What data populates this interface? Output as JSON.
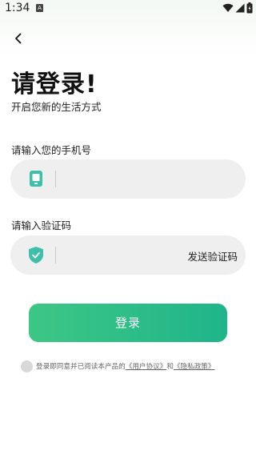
{
  "status_bar": {
    "time": "1:34",
    "notification_badge": "A",
    "icons": [
      "wifi-icon",
      "signal-icon",
      "battery-icon"
    ]
  },
  "header": {
    "back_icon": "chevron-left-icon"
  },
  "page": {
    "title": "请登录!",
    "subtitle": "开启您新的生活方式"
  },
  "phone": {
    "label": "请输入您的手机号",
    "icon": "phone-icon",
    "value": "",
    "placeholder": ""
  },
  "code": {
    "label": "请输入验证码",
    "icon": "shield-check-icon",
    "value": "",
    "placeholder": "",
    "send_label": "发送验证码"
  },
  "login": {
    "label": "登录"
  },
  "agreement": {
    "text": "登录即同意并已阅读本产品的",
    "user_agreement": "《用户协议》",
    "joiner": "和",
    "privacy_policy": "《隐私政策》"
  },
  "colors": {
    "accent_start": "#3dc785",
    "accent_end": "#1fb48a",
    "icon_teal": "#3fbfa9",
    "field_bg": "#efefef"
  }
}
